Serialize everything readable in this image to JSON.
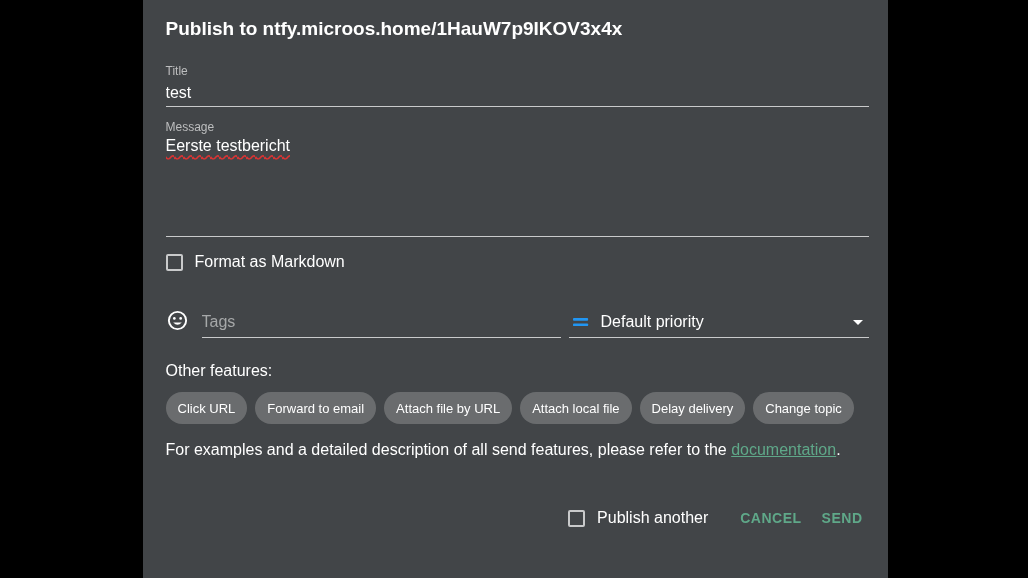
{
  "dialog": {
    "title": "Publish to ntfy.microos.home/1HauW7p9IKOV3x4x"
  },
  "title_field": {
    "label": "Title",
    "value": "test"
  },
  "message_field": {
    "label": "Message",
    "value": "Eerste testbericht"
  },
  "markdown": {
    "label": "Format as Markdown",
    "checked": false
  },
  "tags_field": {
    "placeholder": "Tags"
  },
  "priority": {
    "value": "Default priority"
  },
  "other_features": {
    "label": "Other features:",
    "chips": [
      "Click URL",
      "Forward to email",
      "Attach file by URL",
      "Attach local file",
      "Delay delivery",
      "Change topic"
    ]
  },
  "help": {
    "before": "For examples and a detailed description of all send features, please refer to the ",
    "link": "documentation",
    "after": "."
  },
  "footer": {
    "publish_another": {
      "label": "Publish another",
      "checked": false
    },
    "buttons": [
      "CANCEL",
      "SEND"
    ]
  }
}
